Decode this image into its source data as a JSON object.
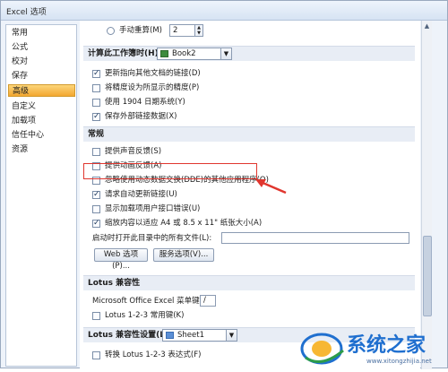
{
  "window": {
    "title": "Excel 选项"
  },
  "sidebar": {
    "items": [
      {
        "label": "常用"
      },
      {
        "label": "公式"
      },
      {
        "label": "校对"
      },
      {
        "label": "保存"
      },
      {
        "label": "高级"
      },
      {
        "label": "自定义"
      },
      {
        "label": "加载项"
      },
      {
        "label": "信任中心"
      },
      {
        "label": "资源"
      }
    ],
    "selected": "高级"
  },
  "top": {
    "manual_recalc_label": "手动重算(M)",
    "manual_recalc_value": "2"
  },
  "calc_section": {
    "title": "计算此工作簿时(H):",
    "workbook": "Book2",
    "options": [
      {
        "label": "更新指向其他文档的链接(D)",
        "checked": true
      },
      {
        "label": "将精度设为所显示的精度(P)",
        "checked": false
      },
      {
        "label": "使用 1904 日期系统(Y)",
        "checked": false
      },
      {
        "label": "保存外部链接数据(X)",
        "checked": true
      }
    ]
  },
  "general_section": {
    "title": "常规",
    "options": [
      {
        "label": "提供声音反馈(S)",
        "checked": false
      },
      {
        "label": "提供动画反馈(A)",
        "checked": false
      },
      {
        "label": "忽略使用动态数据交换(DDE)的其他应用程序(O)",
        "checked": false
      },
      {
        "label": "请求自动更新链接(U)",
        "checked": true
      },
      {
        "label": "显示加载项用户接口错误(U)",
        "checked": false
      },
      {
        "label": "缩放内容以适应 A4 或 8.5 x 11\" 纸张大小(A)",
        "checked": true
      }
    ],
    "startup_label": "启动时打开此目录中的所有文件(L):",
    "startup_value": "",
    "web_options_button": "Web 选项(P)...",
    "service_options_button": "服务选项(V)..."
  },
  "lotus_section": {
    "title": "Lotus 兼容性",
    "menu_key_label": "Microsoft Office Excel 菜单键(M):",
    "menu_key_value": "/",
    "nav_keys_label": "Lotus 1-2-3 常用键(K)",
    "nav_keys_checked": false
  },
  "lotus_settings_section": {
    "title": "Lotus 兼容性设置(L):",
    "sheet": "Sheet1",
    "formula_eval_label": "转换 Lotus 1-2-3 表达式(F)",
    "formula_eval_checked": false
  },
  "watermark": {
    "text": "系统之家",
    "url": "www.xitongzhijia.net"
  },
  "colors": {
    "accent_selected": "#f3a731",
    "annotation_red": "#e0362e",
    "watermark_blue": "#1f6fcf"
  }
}
